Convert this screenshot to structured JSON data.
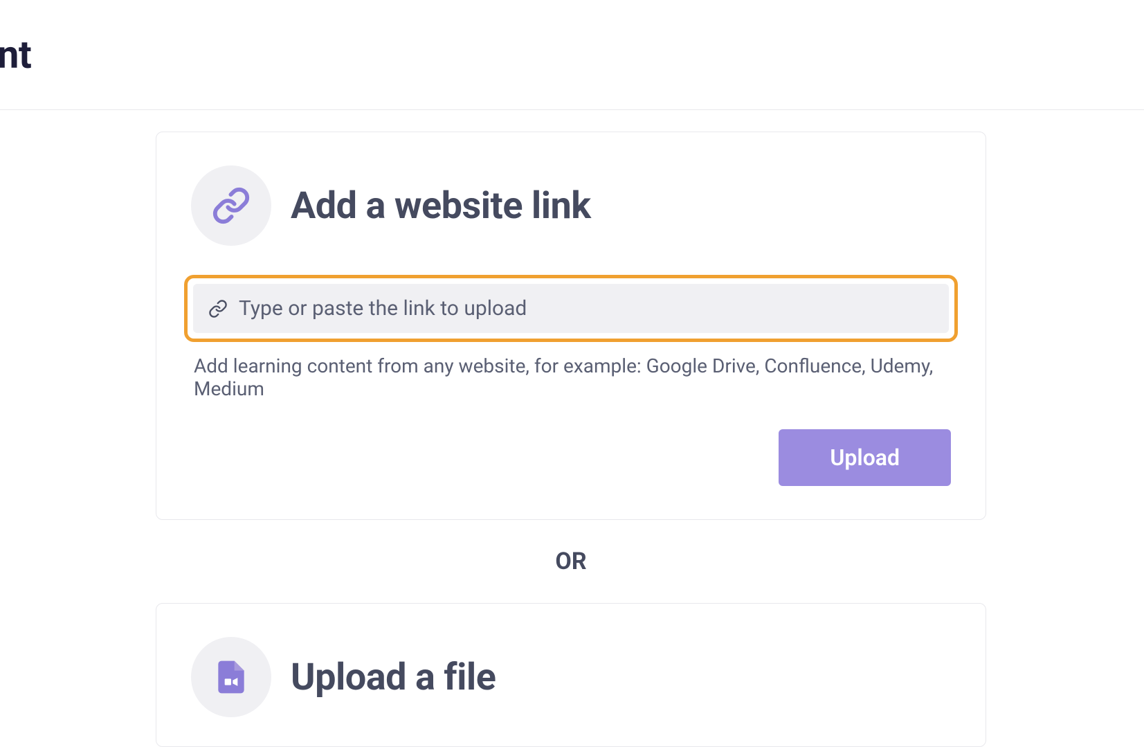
{
  "page": {
    "title_fragment": "nt"
  },
  "link_card": {
    "title": "Add a website link",
    "input_placeholder": "Type or paste the link to upload",
    "helper_text": "Add learning content from any website, for example: Google Drive, Confluence, Udemy, Medium",
    "upload_button": "Upload"
  },
  "separator": {
    "text": "OR"
  },
  "file_card": {
    "title": "Upload a file"
  },
  "colors": {
    "accent": "#9b8ce0",
    "highlight": "#f0a030",
    "text_primary": "#454a5f",
    "text_dark": "#1e1e3a"
  }
}
